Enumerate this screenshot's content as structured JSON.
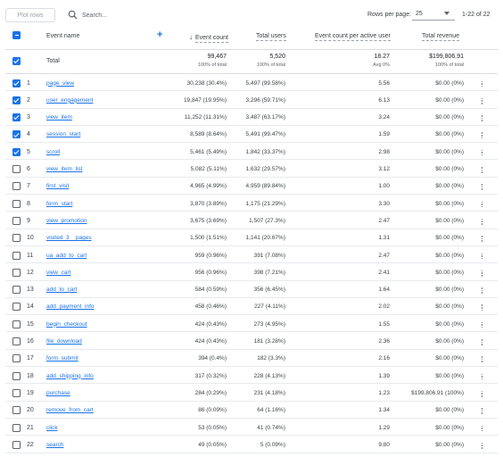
{
  "toolbar": {
    "plot_rows_label": "Plot rows",
    "search_placeholder": "Search...",
    "rows_per_page_label": "Rows per page:",
    "rows_per_page_value": "25",
    "range_label": "1-22 of 22"
  },
  "columns": {
    "event_name": "Event name",
    "event_count": "Event count",
    "total_users": "Total users",
    "count_per_user": "Event count per active user",
    "total_revenue": "Total revenue"
  },
  "totals": {
    "label": "Total",
    "event_count": "99,467",
    "event_count_sub": "100% of total",
    "total_users": "5,520",
    "total_users_sub": "100% of total",
    "count_per_user": "18.27",
    "count_per_user_sub": "Avg 0%",
    "total_revenue": "$199,806.91",
    "total_revenue_sub": "100% of total"
  },
  "rows": [
    {
      "num": "1",
      "name": "page_view",
      "checked": true,
      "event_count": "30,238 (30.4%)",
      "users": "5,497 (99.58%)",
      "per_user": "5.56",
      "revenue": "$0.00 (0%)"
    },
    {
      "num": "2",
      "name": "user_engagement",
      "checked": true,
      "event_count": "19,847 (19.95%)",
      "users": "3,296 (59.71%)",
      "per_user": "6.13",
      "revenue": "$0.00 (0%)"
    },
    {
      "num": "3",
      "name": "view_item",
      "checked": true,
      "event_count": "11,252 (11.31%)",
      "users": "3,487 (63.17%)",
      "per_user": "3.24",
      "revenue": "$0.00 (0%)"
    },
    {
      "num": "4",
      "name": "session_start",
      "checked": true,
      "event_count": "8,589 (8.64%)",
      "users": "5,491 (99.47%)",
      "per_user": "1.59",
      "revenue": "$0.00 (0%)"
    },
    {
      "num": "5",
      "name": "scroll",
      "checked": true,
      "event_count": "5,461 (5.49%)",
      "users": "1,842 (33.37%)",
      "per_user": "2.98",
      "revenue": "$0.00 (0%)"
    },
    {
      "num": "6",
      "name": "view_item_list",
      "checked": false,
      "event_count": "5,082 (5.11%)",
      "users": "1,632 (29.57%)",
      "per_user": "3.12",
      "revenue": "$0.00 (0%)"
    },
    {
      "num": "7",
      "name": "first_visit",
      "checked": false,
      "event_count": "4,965 (4.99%)",
      "users": "4,959 (89.84%)",
      "per_user": "1.00",
      "revenue": "$0.00 (0%)"
    },
    {
      "num": "8",
      "name": "form_start",
      "checked": false,
      "event_count": "3,870 (3.89%)",
      "users": "1,175 (21.29%)",
      "per_user": "3.30",
      "revenue": "$0.00 (0%)"
    },
    {
      "num": "9",
      "name": "view_promotion",
      "checked": false,
      "event_count": "3,675 (3.69%)",
      "users": "1,507 (27.3%)",
      "per_user": "2.47",
      "revenue": "$0.00 (0%)"
    },
    {
      "num": "10",
      "name": "visited_3__pages",
      "checked": false,
      "event_count": "1,500 (1.51%)",
      "users": "1,141 (20.67%)",
      "per_user": "1.31",
      "revenue": "$0.00 (0%)"
    },
    {
      "num": "11",
      "name": "ua_add_to_cart",
      "checked": false,
      "event_count": "959 (0.96%)",
      "users": "391 (7.08%)",
      "per_user": "2.47",
      "revenue": "$0.00 (0%)"
    },
    {
      "num": "12",
      "name": "view_cart",
      "checked": false,
      "event_count": "956 (0.96%)",
      "users": "398 (7.21%)",
      "per_user": "2.41",
      "revenue": "$0.00 (0%)"
    },
    {
      "num": "13",
      "name": "add_to_cart",
      "checked": false,
      "event_count": "584 (0.59%)",
      "users": "356 (6.45%)",
      "per_user": "1.64",
      "revenue": "$0.00 (0%)"
    },
    {
      "num": "14",
      "name": "add_payment_info",
      "checked": false,
      "event_count": "458 (0.46%)",
      "users": "227 (4.11%)",
      "per_user": "2.02",
      "revenue": "$0.00 (0%)"
    },
    {
      "num": "15",
      "name": "begin_checkout",
      "checked": false,
      "event_count": "424 (0.43%)",
      "users": "273 (4.95%)",
      "per_user": "1.55",
      "revenue": "$0.00 (0%)"
    },
    {
      "num": "16",
      "name": "file_download",
      "checked": false,
      "event_count": "424 (0.43%)",
      "users": "181 (3.28%)",
      "per_user": "2.36",
      "revenue": "$0.00 (0%)"
    },
    {
      "num": "17",
      "name": "form_submit",
      "checked": false,
      "event_count": "394 (0.4%)",
      "users": "182 (3.3%)",
      "per_user": "2.16",
      "revenue": "$0.00 (0%)"
    },
    {
      "num": "18",
      "name": "add_shipping_info",
      "checked": false,
      "event_count": "317 (0.32%)",
      "users": "228 (4.13%)",
      "per_user": "1.39",
      "revenue": "$0.00 (0%)"
    },
    {
      "num": "19",
      "name": "purchase",
      "checked": false,
      "event_count": "284 (0.29%)",
      "users": "231 (4.18%)",
      "per_user": "1.23",
      "revenue": "$199,806.91 (100%)"
    },
    {
      "num": "20",
      "name": "remove_from_cart",
      "checked": false,
      "event_count": "86 (0.09%)",
      "users": "64 (1.16%)",
      "per_user": "1.34",
      "revenue": "$0.00 (0%)"
    },
    {
      "num": "21",
      "name": "click",
      "checked": false,
      "event_count": "53 (0.05%)",
      "users": "41 (0.74%)",
      "per_user": "1.29",
      "revenue": "$0.00 (0%)"
    },
    {
      "num": "22",
      "name": "search",
      "checked": false,
      "event_count": "49 (0.05%)",
      "users": "5 (0.09%)",
      "per_user": "9.80",
      "revenue": "$0.00 (0%)"
    }
  ]
}
